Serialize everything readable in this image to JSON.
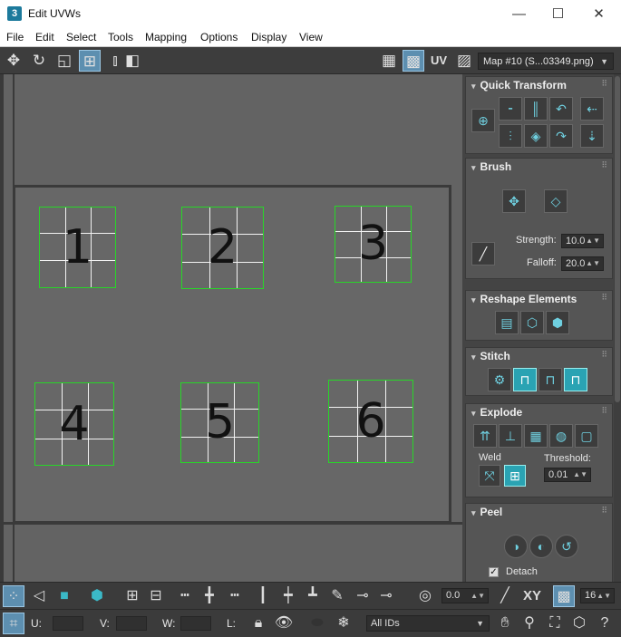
{
  "window": {
    "title": "Edit UVWs",
    "icon": "3",
    "minimize": "—",
    "maximize": "☐",
    "close": "✕"
  },
  "menu": [
    "File",
    "Edit",
    "Select",
    "Tools",
    "Mapping",
    "Options",
    "Display",
    "View"
  ],
  "toolbar": {
    "uv_label": "UV",
    "map_select": "Map #10 (S...03349.png)"
  },
  "uv_cells": [
    "1",
    "2",
    "3",
    "4",
    "5",
    "6"
  ],
  "panel": {
    "quick_transform": "Quick Transform",
    "brush": "Brush",
    "strength_label": "Strength:",
    "strength_value": "10.0",
    "falloff_label": "Falloff:",
    "falloff_value": "20.0",
    "reshape_elements": "Reshape Elements",
    "stitch": "Stitch",
    "explode": "Explode",
    "weld_label": "Weld",
    "threshold_label": "Threshold:",
    "threshold_value": "0.01",
    "peel": "Peel",
    "detach_label": "Detach",
    "detach_checked": true
  },
  "bottom": {
    "rotate_value": "0.0",
    "xy_label": "XY",
    "grid_value": "16",
    "u_label": "U:",
    "v_label": "V:",
    "w_label": "W:",
    "l_label": "L:",
    "ids_select": "All IDs"
  }
}
